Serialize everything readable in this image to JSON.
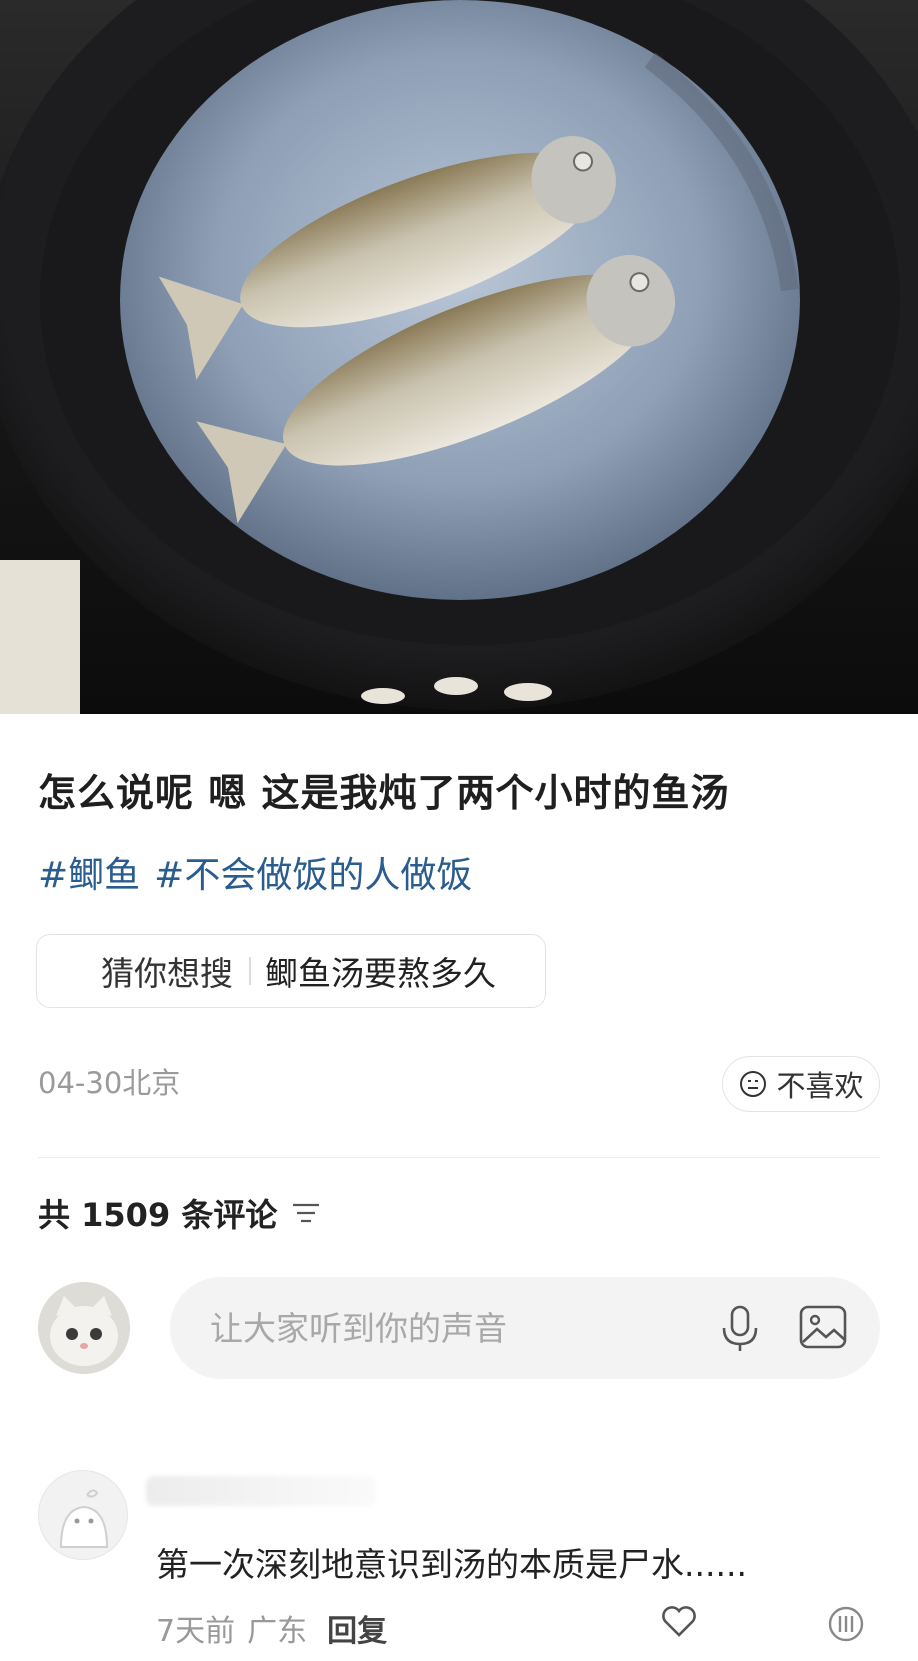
{
  "post": {
    "title": "怎么说呢 嗯 这是我炖了两个小时的鱼汤",
    "tags": [
      "#鲫鱼",
      "#不会做饭的人做饭"
    ],
    "suggestion": {
      "label": "猜你想搜",
      "query": "鲫鱼汤要熬多久"
    },
    "date_location": "04-30北京",
    "dislike_label": "不喜欢"
  },
  "comments_header": {
    "label": "共 1509 条评论"
  },
  "comment_input": {
    "placeholder": "让大家听到你的声音"
  },
  "comments": [
    {
      "text": "第一次深刻地意识到汤的本质是尸水......",
      "time": "7天前",
      "location": "广东",
      "reply_label": "回复"
    }
  ]
}
